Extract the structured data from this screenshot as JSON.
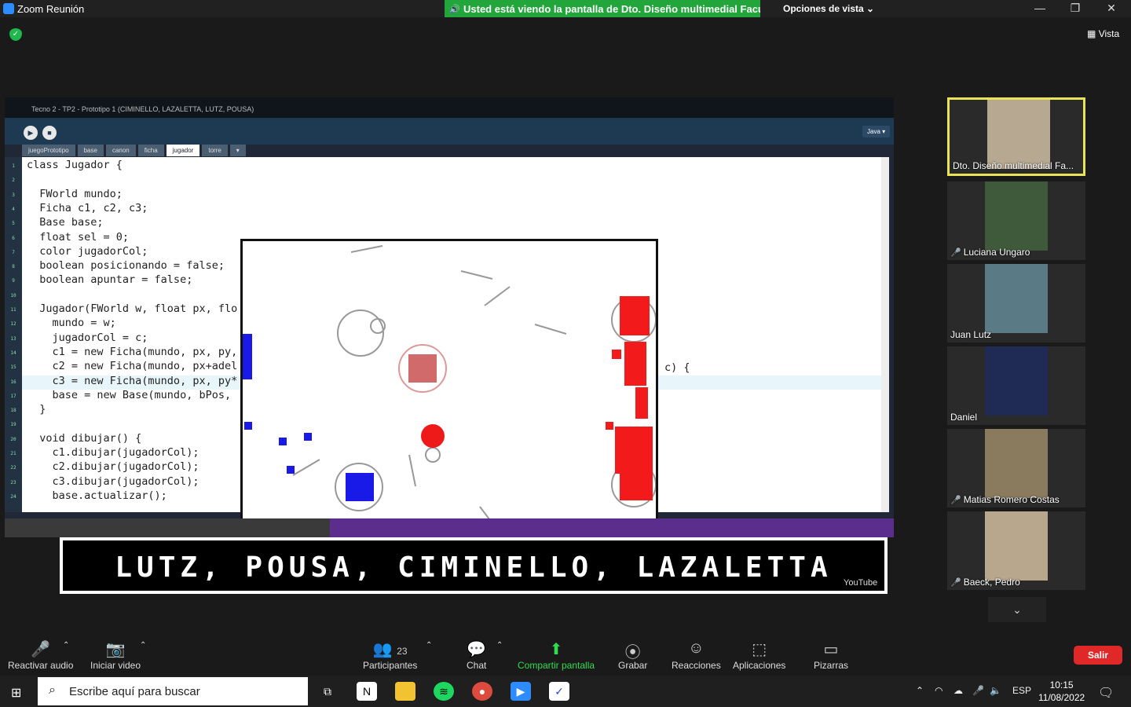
{
  "app": {
    "title": "Zoom Reunión",
    "banner": "Usted está viendo la pantalla de Dto. Diseño multimedial Facult...",
    "view_options": "Opciones de vista",
    "view": "Vista"
  },
  "ide": {
    "title": "Tecno 2 - TP2 - Prototipo 1 (CIMINELLO, LAZALETTA, LUTZ, POUSA)",
    "mode": "Java ▾",
    "tabs": [
      "juegoPrototipo",
      "base",
      "canon",
      "ficha",
      "jugador",
      "torre",
      "▾"
    ]
  },
  "code": [
    "class Jugador {",
    "",
    "  FWorld mundo;",
    "  Ficha c1, c2, c3;",
    "  Base base;",
    "  float sel = 0;",
    "  color jugadorCol;",
    "  boolean posicionando = false;",
    "  boolean apuntar = false;",
    "",
    "  Jugador(FWorld w, float px, flo",
    "    mundo = w;",
    "    jugadorCol = c;",
    "    c1 = new Ficha(mundo, px, py,",
    "    c2 = new Ficha(mundo, px+adel",
    "    c3 = new Ficha(mundo, px, py*",
    "    base = new Base(mundo, bPos,",
    "  }",
    "",
    "  void dibujar() {",
    "    c1.dibujar(jugadorCol);",
    "    c2.dibujar(jugadorCol);",
    "    c3.dibujar(jugadorCol);",
    "    base.actualizar();"
  ],
  "code_tail": "c) {",
  "caption": "LUTZ, POUSA, CIMINELLO, LAZALETTA",
  "youtube": "YouTube",
  "participants": [
    {
      "name": "Dto. Diseño multimedial Fa...",
      "muted": false,
      "color": "#b7a892"
    },
    {
      "name": "Luciana Ungaro",
      "muted": true,
      "color": "#3f5a3a"
    },
    {
      "name": "Juan Lutz",
      "muted": false,
      "color": "#5a7a86"
    },
    {
      "name": "Daniel",
      "muted": false,
      "color": "#1f2a55"
    },
    {
      "name": "Matias Romero Costas",
      "muted": true,
      "color": "#8a7a5e"
    },
    {
      "name": "Baeck, Pedro",
      "muted": true,
      "color": "#b8a78c"
    }
  ],
  "controls": {
    "audio": "Reactivar audio",
    "video": "Iniciar video",
    "participants": "Participantes",
    "participants_count": "23",
    "chat": "Chat",
    "share": "Compartir pantalla",
    "record": "Grabar",
    "reactions": "Reacciones",
    "apps": "Aplicaciones",
    "whiteboards": "Pizarras",
    "leave": "Salir"
  },
  "taskbar": {
    "search_placeholder": "Escribe aquí para buscar",
    "lang": "ESP",
    "time": "10:15",
    "date": "11/08/2022"
  }
}
